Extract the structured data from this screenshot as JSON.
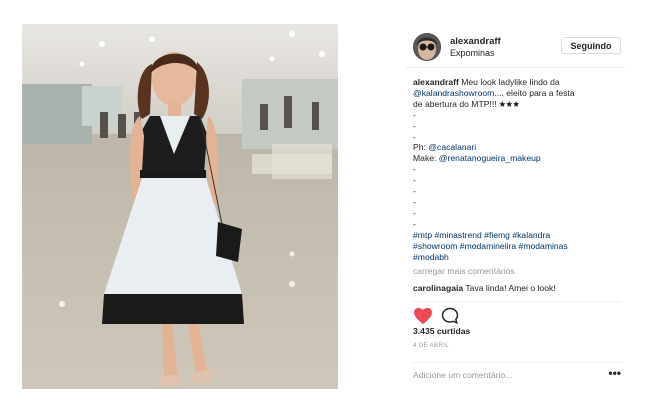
{
  "post": {
    "photo_icon": "photo-of-woman-in-dress",
    "username": "alexandraff",
    "location": "Expominas",
    "follow_label": "Seguindo",
    "caption_lines": [
      [
        {
          "t": "alexandraff",
          "s": "b"
        },
        {
          "t": " Meu look ladylike lindo da",
          "s": ""
        }
      ],
      [
        {
          "t": "@kalandrashowroom",
          "s": "lnk"
        },
        {
          "t": ".... eleito para a festa",
          "s": ""
        }
      ],
      [
        {
          "t": "de abertura do MTP!!! 🟊🟊🟊",
          "s": ""
        }
      ],
      [
        {
          "t": "-",
          "s": ""
        }
      ],
      [
        {
          "t": "-",
          "s": ""
        }
      ],
      [
        {
          "t": "-",
          "s": ""
        }
      ],
      [
        {
          "t": "Ph: ",
          "s": ""
        },
        {
          "t": "@cacalanari",
          "s": "lnk"
        }
      ],
      [
        {
          "t": "Make: ",
          "s": ""
        },
        {
          "t": "@renatanogueira_makeup",
          "s": "lnk"
        }
      ],
      [
        {
          "t": "-",
          "s": ""
        }
      ],
      [
        {
          "t": "-",
          "s": ""
        }
      ],
      [
        {
          "t": "-",
          "s": ""
        }
      ],
      [
        {
          "t": "-",
          "s": ""
        }
      ],
      [
        {
          "t": "-",
          "s": ""
        }
      ],
      [
        {
          "t": "-",
          "s": ""
        }
      ],
      [
        {
          "t": "#mtp #minastrend #fiemg #kalandra",
          "s": "lnk"
        }
      ],
      [
        {
          "t": "#showroom #modamineiira #modaminas",
          "s": "lnk"
        }
      ],
      [
        {
          "t": "#modabh",
          "s": "lnk"
        }
      ]
    ],
    "load_more": "carregar mais comentários",
    "comment": {
      "user": "carolinagaia",
      "text": " Tava linda! Amei o look!"
    },
    "likes": "3.435 curtidas",
    "date": "4 DE ABRIL",
    "add_comment_placeholder": "Adicione um comentário...",
    "more_icon": "more-options-icon",
    "heart_icon": "heart-icon",
    "comment_icon": "comment-icon",
    "heart_color": "#ed4956"
  }
}
